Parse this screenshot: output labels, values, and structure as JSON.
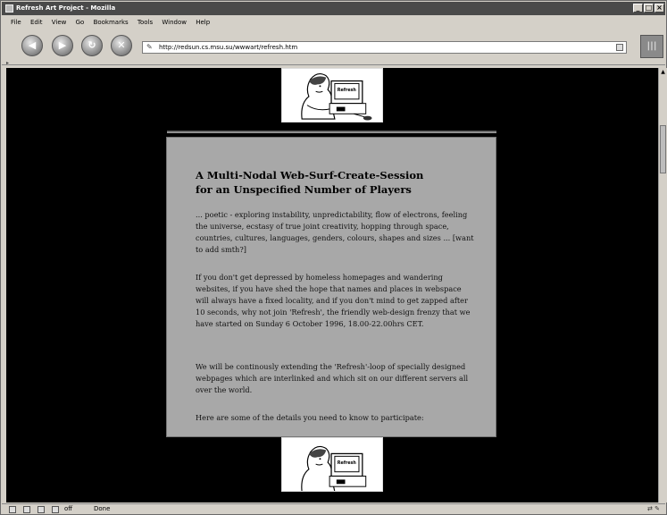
{
  "window": {
    "title": "Refresh Art Project - Mozilla",
    "minimize_glyph": "_",
    "maximize_glyph": "□",
    "close_glyph": "×"
  },
  "menu": [
    "File",
    "Edit",
    "View",
    "Go",
    "Bookmarks",
    "Tools",
    "Window",
    "Help"
  ],
  "toolbar": {
    "back_icon": "back-arrow-icon",
    "forward_icon": "forward-arrow-icon",
    "reload_icon": "reload-icon",
    "stop_icon": "stop-icon",
    "url": "http://redsun.cs.msu.su/wwwart/refresh.htm"
  },
  "page": {
    "heading_line1": "A Multi-Nodal Web-Surf-Create-Session",
    "heading_line2": "for an Unspecified Number of Players",
    "para1": "... poetic - exploring instability, unpredictability, flow of electrons, feeling the universe, ecstasy of true joint creativity, hopping through space, countries, cultures, languages, genders, colours, shapes and sizes ... [want to add smth?]",
    "para2": "If you don't get depressed by homeless homepages and wandering websites, if you have shed the hope that names and places in webspace will always have a fixed locality, and if you don't mind to get zapped after 10 seconds, why not join 'Refresh', the friendly web-design frenzy that we have started on Sunday 6 October 1996, 18.00-22.00hrs CET.",
    "para3": "We will be continously extending the 'Refresh'-loop of specially designed webpages which are interlinked and which sit on our different servers all over the world.",
    "para4": "Here are some of the details you need to know to participate:",
    "art_sign_text": "Refresh"
  },
  "status": {
    "text": "Done",
    "offline_label": "off"
  },
  "colors": {
    "viewport_bg": "#000000",
    "panel_bg": "#a8a8a8",
    "chrome_bg": "#d4d0c8"
  }
}
